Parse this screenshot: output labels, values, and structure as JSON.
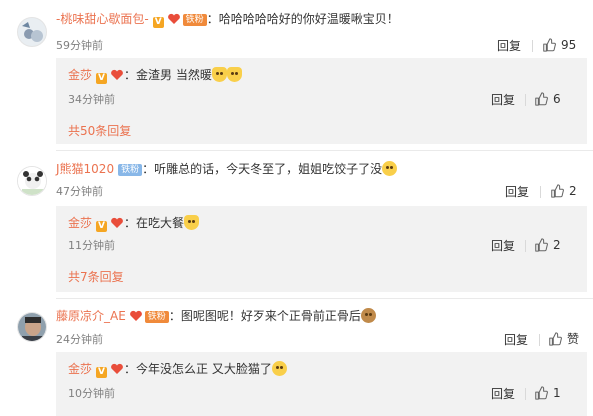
{
  "colors": {
    "username": "#eb7350",
    "badge_v": "#f5a623",
    "fan_iron": "#f08a3b",
    "fan_blue": "#88b7e8",
    "reply_bg": "#f2f2f2"
  },
  "reply_label": "回复",
  "comments": [
    {
      "user": "-桃味甜心歇面包-",
      "fan_badge": "铁粉",
      "text": "：哈哈哈哈哈好的你好温暖啾宝贝！",
      "time": "59分钟前",
      "likes": "95",
      "replies": [
        {
          "user": "金莎",
          "text": "：金渣男 当然暖",
          "time": "34分钟前",
          "likes": "6"
        }
      ],
      "more": "共50条回复"
    },
    {
      "user": "J熊猫1020",
      "fan_badge": "铁粉",
      "text": "：听雕总的话，今天冬至了，姐姐吃饺子了没",
      "time": "47分钟前",
      "likes": "2",
      "replies": [
        {
          "user": "金莎",
          "text": "：在吃大餐",
          "time": "11分钟前",
          "likes": "2"
        }
      ],
      "more": "共7条回复"
    },
    {
      "user": "藤原凉介_AE",
      "fan_badge": "铁粉",
      "text": "：图呢图呢！好歹来个正骨前正骨后",
      "time": "24分钟前",
      "likes": "赞",
      "replies": [
        {
          "user": "金莎",
          "text": "：今年没怎么正 又大脸猫了",
          "time": "10分钟前",
          "likes": "1"
        }
      ]
    }
  ]
}
